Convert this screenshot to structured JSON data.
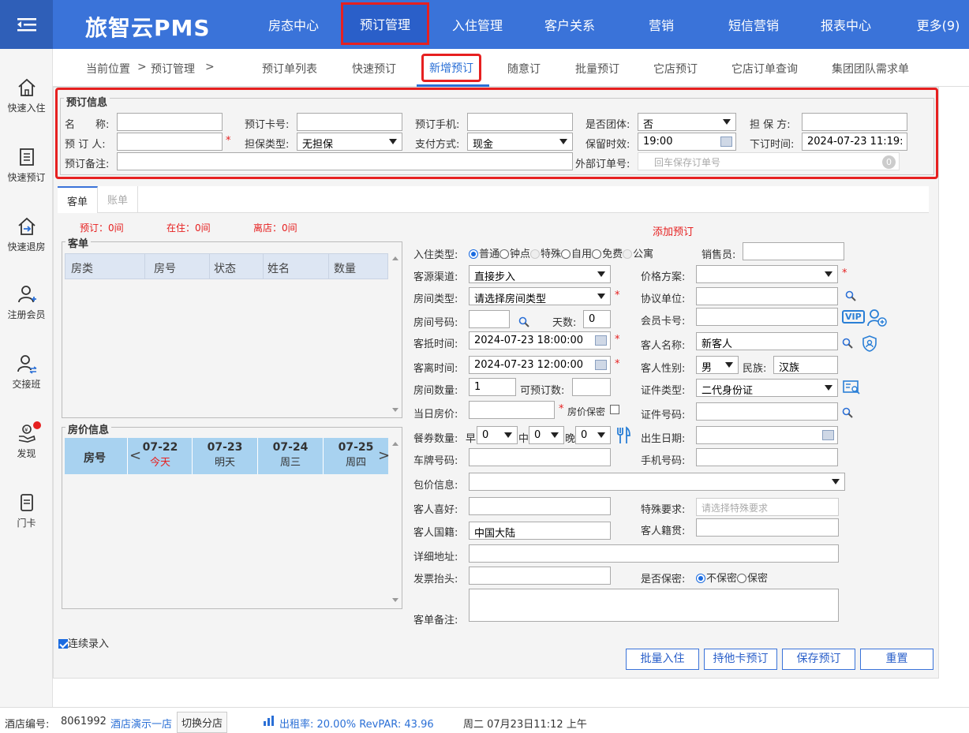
{
  "app": {
    "title": "旅智云PMS"
  },
  "nav": [
    "房态中心",
    "预订管理",
    "入住管理",
    "客户关系",
    "营销",
    "短信营销",
    "报表中心",
    "更多(9)"
  ],
  "breadcrumb": {
    "label": "当前位置",
    "sep": ">",
    "current": "预订管理",
    "tail": ">"
  },
  "subnav": [
    "预订单列表",
    "快速预订",
    "新增预订",
    "随意订",
    "批量预订",
    "它店预订",
    "它店订单查询",
    "集团团队需求单"
  ],
  "sidebar": [
    "快速入住",
    "快速预订",
    "快速退房",
    "注册会员",
    "交接班",
    "发现",
    "门卡"
  ],
  "reservation_info": {
    "legend": "预订信息",
    "name_label": "名　　称:",
    "name_value": "",
    "card_label": "预订卡号:",
    "card_value": "",
    "phone_label": "预订手机:",
    "phone_value": "",
    "group_label": "是否团体:",
    "group_value": "否",
    "guarantor_label": "担 保 方:",
    "guarantor_value": "",
    "booker_label": "预 订 人:",
    "booker_value": "",
    "guarantee_type_label": "担保类型:",
    "guarantee_type_value": "无担保",
    "payment_label": "支付方式:",
    "payment_value": "现金",
    "hold_label": "保留时效:",
    "hold_value": "19:00",
    "order_time_label": "下订时间:",
    "order_time_value": "2024-07-23 11:19:",
    "remark_label": "预订备注:",
    "remark_value": "",
    "ext_order_label": "外部订单号:",
    "ext_order_placeholder": "回车保存订单号",
    "ext_order_count": "0"
  },
  "tabs": [
    "客单",
    "账单"
  ],
  "counts": {
    "reserved": "预订：0间",
    "in_house": "在住：0间",
    "departed": "离店：0间"
  },
  "add_reservation": "添加预订",
  "guest_panel": {
    "title": "客单",
    "columns": [
      "房类",
      "房号",
      "状态",
      "姓名",
      "数量"
    ]
  },
  "price_panel": {
    "title": "房价信息",
    "room_col": "房号",
    "days": [
      {
        "date": "07-22",
        "label": "今天"
      },
      {
        "date": "07-23",
        "label": "明天"
      },
      {
        "date": "07-24",
        "label": "周三"
      },
      {
        "date": "07-25",
        "label": "周四"
      }
    ],
    "prev": "<",
    "next": ">"
  },
  "form": {
    "checkin_type_label": "入住类型:",
    "checkin_types": [
      "普通",
      "钟点",
      "特殊",
      "自用",
      "免费",
      "公寓"
    ],
    "sales_label": "销售员:",
    "sales_value": "",
    "source_label": "客源渠道:",
    "source_value": "直接步入",
    "price_plan_label": "价格方案:",
    "price_plan_value": "",
    "room_type_label": "房间类型:",
    "room_type_value": "请选择房间类型",
    "agreement_label": "协议单位:",
    "agreement_value": "",
    "room_no_label": "房间号码:",
    "room_no_value": "",
    "days_label": "天数:",
    "days_value": "0",
    "member_label": "会员卡号:",
    "member_value": "",
    "vip": "VIP",
    "arrive_label": "客抵时间:",
    "arrive_value": "2024-07-23 18:00:00",
    "guest_name_label": "客人名称:",
    "guest_name_value": "新客人",
    "depart_label": "客离时间:",
    "depart_value": "2024-07-23 12:00:00",
    "gender_label": "客人性别:",
    "gender_value": "男",
    "ethnic_label": "民族:",
    "ethnic_value": "汉族",
    "room_count_label": "房间数量:",
    "room_count_value": "1",
    "avail_label": "可预订数:",
    "avail_value": "",
    "id_type_label": "证件类型:",
    "id_type_value": "二代身份证",
    "day_price_label": "当日房价:",
    "day_price_value": "",
    "price_secret_label": "房价保密",
    "id_no_label": "证件号码:",
    "id_no_value": "",
    "meal_label": "餐券数量:",
    "breakfast_label": "早",
    "breakfast_value": "0",
    "lunch_label": "中",
    "lunch_value": "0",
    "dinner_label": "晚",
    "dinner_value": "0",
    "birth_label": "出生日期:",
    "birth_value": "",
    "plate_label": "车牌号码:",
    "plate_value": "",
    "mobile_label": "手机号码:",
    "mobile_value": "",
    "package_label": "包价信息:",
    "package_value": "",
    "preference_label": "客人喜好:",
    "preference_value": "",
    "special_label": "特殊要求:",
    "special_placeholder": "请选择特殊要求",
    "nationality_label": "客人国籍:",
    "nationality_value": "中国大陆",
    "origin_label": "客人籍贯:",
    "origin_value": "",
    "address_label": "详细地址:",
    "address_value": "",
    "invoice_label": "发票抬头:",
    "invoice_value": "",
    "secret_label": "是否保密:",
    "secret_options": [
      "不保密",
      "保密"
    ],
    "remark_label": "客单备注:",
    "remark_value": ""
  },
  "continuous_label": "连续录入",
  "buttons": [
    "批量入住",
    "持他卡预订",
    "保存预订",
    "重置"
  ],
  "status": {
    "hotel_no_label": "酒店编号:",
    "hotel_no": "8061992",
    "hotel_name": "酒店演示一店",
    "switch": "切换分店",
    "occupancy": "出租率: 20.00% RevPAR: 43.96",
    "datetime": "周二 07月23日11:12 上午"
  }
}
